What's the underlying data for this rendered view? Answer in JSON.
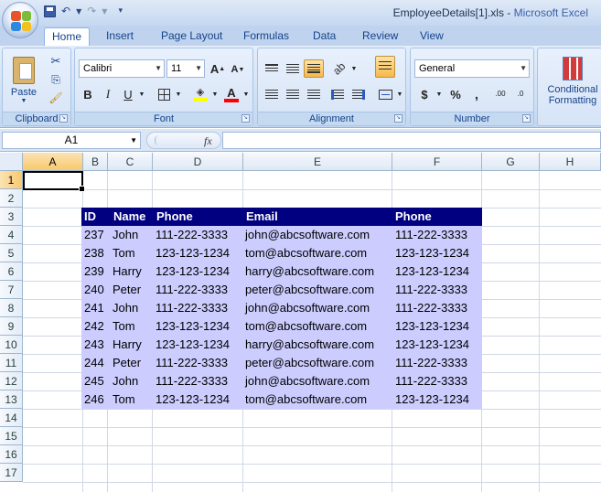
{
  "window": {
    "file_name": "EmployeeDetails[1].xls",
    "separator": " - ",
    "app_name": "Microsoft Excel"
  },
  "tabs": [
    "Home",
    "Insert",
    "Page Layout",
    "Formulas",
    "Data",
    "Review",
    "View"
  ],
  "ribbon": {
    "clipboard": {
      "label": "Clipboard",
      "paste": "Paste"
    },
    "font": {
      "label": "Font",
      "name": "Calibri",
      "size": "11",
      "grow": "A",
      "shrink": "A",
      "bold": "B",
      "italic": "I",
      "underline": "U",
      "color_letter": "A"
    },
    "alignment": {
      "label": "Alignment"
    },
    "number": {
      "label": "Number",
      "format": "General",
      "currency": "$",
      "percent": "%",
      "comma": ",",
      "inc_decimal": ".00",
      "dec_decimal": ".0"
    },
    "styles": {
      "conditional_1": "Conditional",
      "conditional_2": "Formatting"
    }
  },
  "formula_bar": {
    "name_box": "A1",
    "fx": "fx",
    "content": ""
  },
  "columns": [
    "A",
    "B",
    "C",
    "D",
    "E",
    "F",
    "G",
    "H"
  ],
  "rows": [
    "1",
    "2",
    "3",
    "4",
    "5",
    "6",
    "7",
    "8",
    "9",
    "10",
    "11",
    "12",
    "13",
    "14",
    "15",
    "16",
    "17"
  ],
  "selected_cell": {
    "column": "A",
    "row": "1"
  },
  "colors": {
    "header_fill": "#000080",
    "body_fill": "#ccccff",
    "header_text": "#ffffff"
  },
  "table": {
    "headers": [
      "ID",
      "Name",
      "Phone",
      "Email",
      "Phone"
    ],
    "rows": [
      [
        "237",
        "John",
        "111-222-3333",
        "john@abcsoftware.com",
        "111-222-3333"
      ],
      [
        "238",
        "Tom",
        "123-123-1234",
        "tom@abcsoftware.com",
        "123-123-1234"
      ],
      [
        "239",
        "Harry",
        "123-123-1234",
        "harry@abcsoftware.com",
        "123-123-1234"
      ],
      [
        "240",
        "Peter",
        "111-222-3333",
        "peter@abcsoftware.com",
        "111-222-3333"
      ],
      [
        "241",
        "John",
        "111-222-3333",
        "john@abcsoftware.com",
        "111-222-3333"
      ],
      [
        "242",
        "Tom",
        "123-123-1234",
        "tom@abcsoftware.com",
        "123-123-1234"
      ],
      [
        "243",
        "Harry",
        "123-123-1234",
        "harry@abcsoftware.com",
        "123-123-1234"
      ],
      [
        "244",
        "Peter",
        "111-222-3333",
        "peter@abcsoftware.com",
        "111-222-3333"
      ],
      [
        "245",
        "John",
        "111-222-3333",
        "john@abcsoftware.com",
        "111-222-3333"
      ],
      [
        "246",
        "Tom",
        "123-123-1234",
        "tom@abcsoftware.com",
        "123-123-1234"
      ]
    ]
  }
}
